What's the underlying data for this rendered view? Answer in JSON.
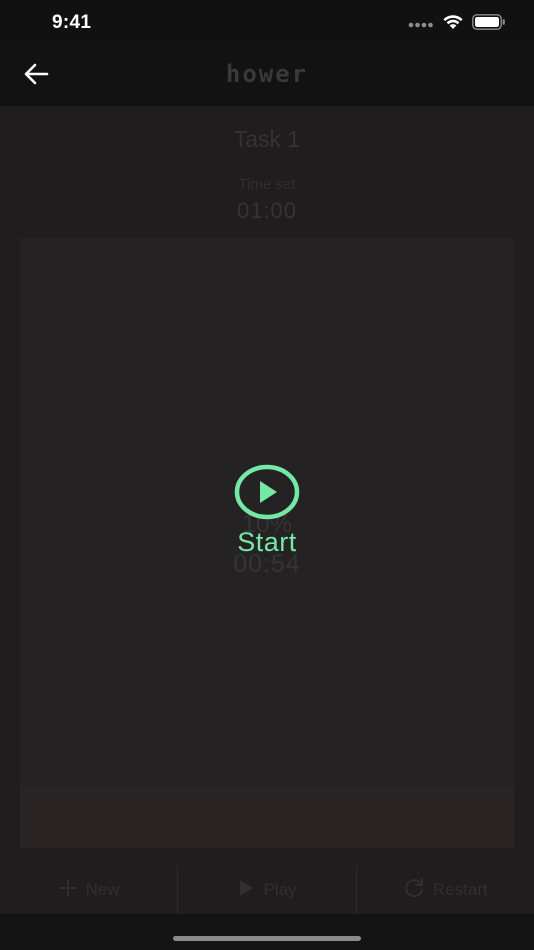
{
  "status_bar": {
    "time": "9:41"
  },
  "nav": {
    "logo_text": "hower",
    "back_icon": "arrow-left-icon"
  },
  "task": {
    "title": "Task 1",
    "time_set_label": "Time set",
    "time_set_value": "01:00"
  },
  "progress": {
    "percent_label": "10%",
    "percent_value": 10,
    "remaining": "00:54"
  },
  "start": {
    "label": "Start",
    "icon": "play-circle-icon"
  },
  "toolbar": {
    "new_label": "New",
    "play_label": "Play",
    "restart_label": "Restart"
  },
  "colors": {
    "accent": "#74e8a5",
    "background": "#1f1d1e",
    "dimmed_text": "#353334"
  }
}
